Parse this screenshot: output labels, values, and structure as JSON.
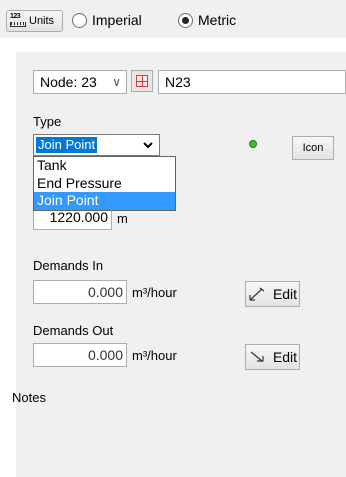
{
  "units_bar": {
    "units_button_label": "Units",
    "units_icon_digits": "123",
    "options": [
      {
        "label": "Imperial",
        "checked": false
      },
      {
        "label": "Metric",
        "checked": true
      }
    ]
  },
  "node": {
    "selector_value": "Node:  23",
    "name_value": "N23"
  },
  "type": {
    "label": "Type",
    "selected": "Join Point",
    "options": [
      "Tank",
      "End Pressure",
      "Join Point"
    ],
    "highlighted_option": "Join Point",
    "status_color": "#39c530",
    "icon_button_label": "Icon"
  },
  "elevation": {
    "value": "1220.000",
    "unit": "m"
  },
  "demands_in": {
    "label": "Demands In",
    "value": "0.000",
    "unit": "m³/hour",
    "edit_label": "Edit"
  },
  "demands_out": {
    "label": "Demands Out",
    "value": "0.000",
    "unit": "m³/hour",
    "edit_label": "Edit"
  },
  "notes": {
    "label": "Notes"
  },
  "colors": {
    "selection_blue": "#0078d7",
    "dropdown_highlight": "#3399ff",
    "panel_bg": "#f0f0f0"
  }
}
